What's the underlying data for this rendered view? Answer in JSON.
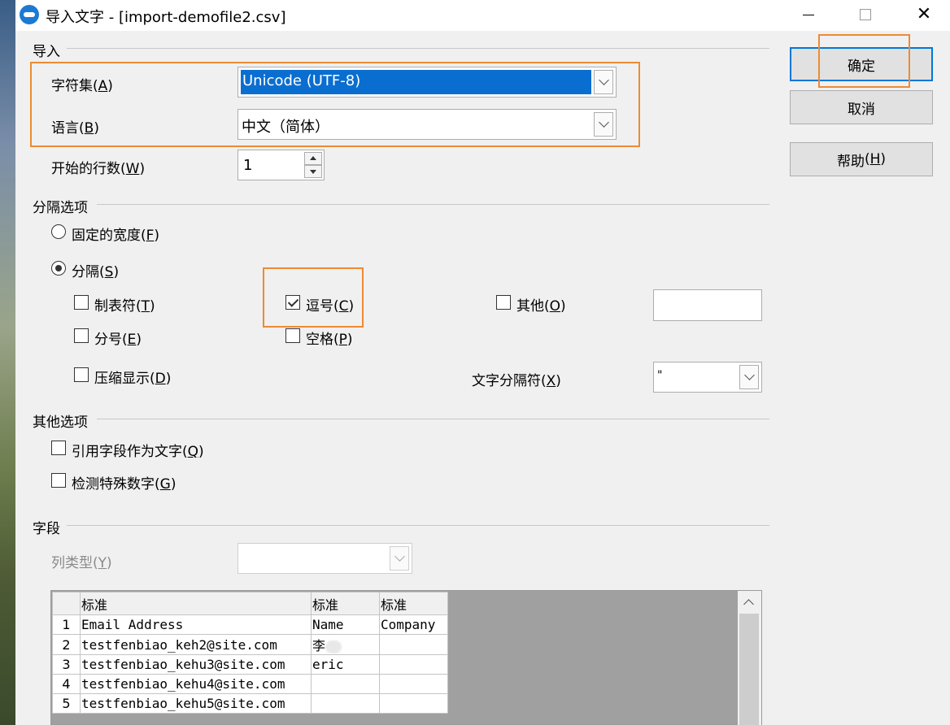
{
  "window": {
    "title": "导入文字 - [import-demofile2.csv]",
    "close_glyph": "✕"
  },
  "import_section": {
    "title": "导入",
    "charset": {
      "label": "字符集",
      "key": "A",
      "value": "Unicode (UTF-8)"
    },
    "language": {
      "label": "语言",
      "key": "B",
      "value": "中文（简体）"
    },
    "start_row": {
      "label": "开始的行数",
      "key": "W",
      "value": "1"
    }
  },
  "separator_section": {
    "title": "分隔选项",
    "fixed_width": {
      "label": "固定的宽度",
      "key": "F",
      "checked": false
    },
    "separated": {
      "label": "分隔",
      "key": "S",
      "checked": true
    },
    "tab": {
      "label": "制表符",
      "key": "T",
      "checked": false
    },
    "comma": {
      "label": "逗号",
      "key": "C",
      "checked": true
    },
    "other": {
      "label": "其他",
      "key": "O",
      "checked": false,
      "value": ""
    },
    "semicolon": {
      "label": "分号",
      "key": "E",
      "checked": false
    },
    "space": {
      "label": "空格",
      "key": "P",
      "checked": false
    },
    "merge": {
      "label": "压缩显示",
      "key": "D",
      "checked": false
    },
    "text_delimiter": {
      "label": "文字分隔符",
      "key": "X",
      "value": "\""
    }
  },
  "other_options": {
    "title": "其他选项",
    "quoted_as_text": {
      "label": "引用字段作为文字",
      "key": "Q",
      "checked": false
    },
    "detect_special": {
      "label": "检测特殊数字",
      "key": "G",
      "checked": false
    }
  },
  "fields": {
    "title": "字段",
    "column_type": {
      "label": "列类型",
      "key": "Y",
      "value": ""
    },
    "preview": {
      "headers": [
        "标准",
        "标准",
        "标准"
      ],
      "rows": [
        {
          "n": "1",
          "cells": [
            "Email Address",
            "Name",
            "Company"
          ]
        },
        {
          "n": "2",
          "cells": [
            "testfenbiao_keh2@site.com",
            "李",
            ""
          ]
        },
        {
          "n": "3",
          "cells": [
            "testfenbiao_kehu3@site.com",
            "eric",
            ""
          ]
        },
        {
          "n": "4",
          "cells": [
            "testfenbiao_kehu4@site.com",
            "",
            ""
          ]
        },
        {
          "n": "5",
          "cells": [
            "testfenbiao_kehu5@site.com",
            "",
            ""
          ]
        }
      ]
    }
  },
  "buttons": {
    "ok": "确定",
    "cancel": "取消",
    "help": {
      "label": "帮助",
      "key": "H"
    }
  },
  "colors": {
    "highlight": "#ed8b32",
    "selection": "#0a6ed1",
    "focus": "#0078d7"
  }
}
